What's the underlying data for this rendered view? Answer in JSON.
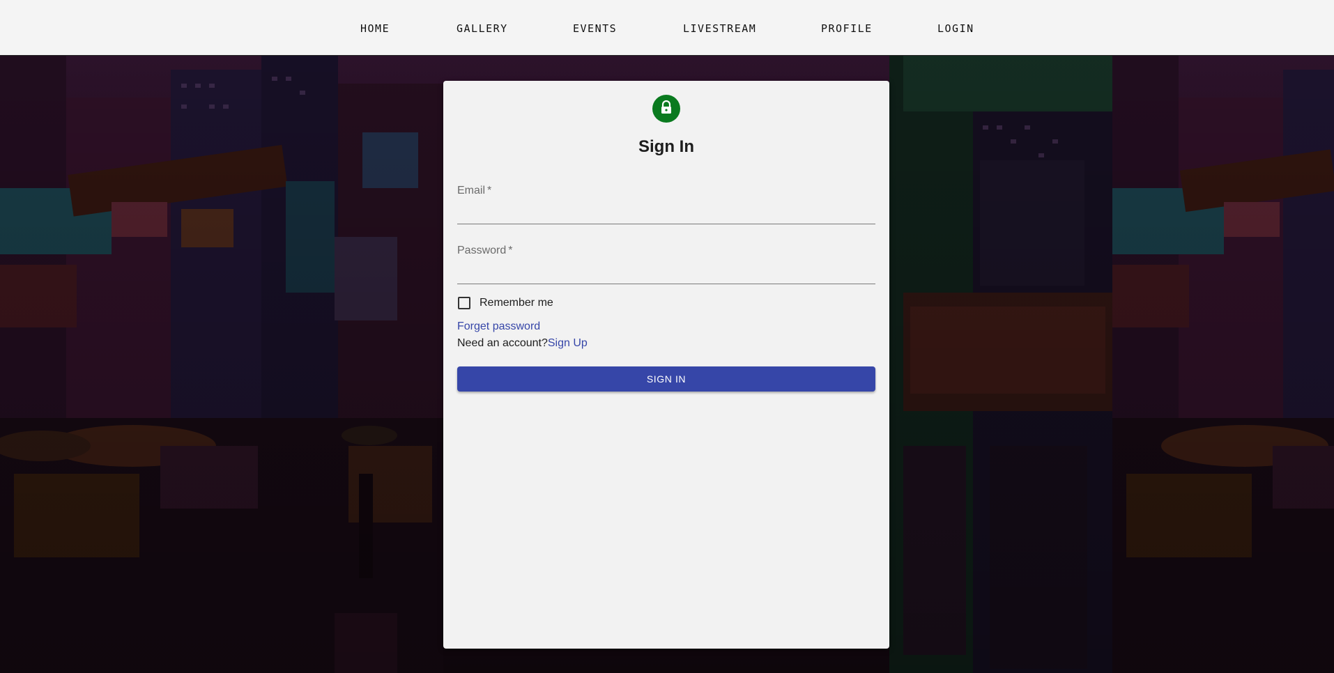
{
  "nav": {
    "items": [
      {
        "label": "HOME"
      },
      {
        "label": "GALLERY"
      },
      {
        "label": "EVENTS"
      },
      {
        "label": "LIVESTREAM"
      },
      {
        "label": "PROFILE"
      },
      {
        "label": "LOGIN"
      }
    ]
  },
  "background": {
    "icon": "neon-city-street-photo"
  },
  "login": {
    "icon": "lock-icon",
    "avatar_color": "#0a7a1f",
    "title": "Sign In",
    "email": {
      "label": "Email",
      "required_marker": "*",
      "value": ""
    },
    "password": {
      "label": "Password",
      "required_marker": "*",
      "value": ""
    },
    "remember": {
      "label": "Remember me",
      "checked": false
    },
    "forget_password": "Forget password",
    "need_account": "Need an account?",
    "sign_up": "Sign Up",
    "submit_label": "SIGN IN",
    "accent_color": "#3646a8"
  }
}
